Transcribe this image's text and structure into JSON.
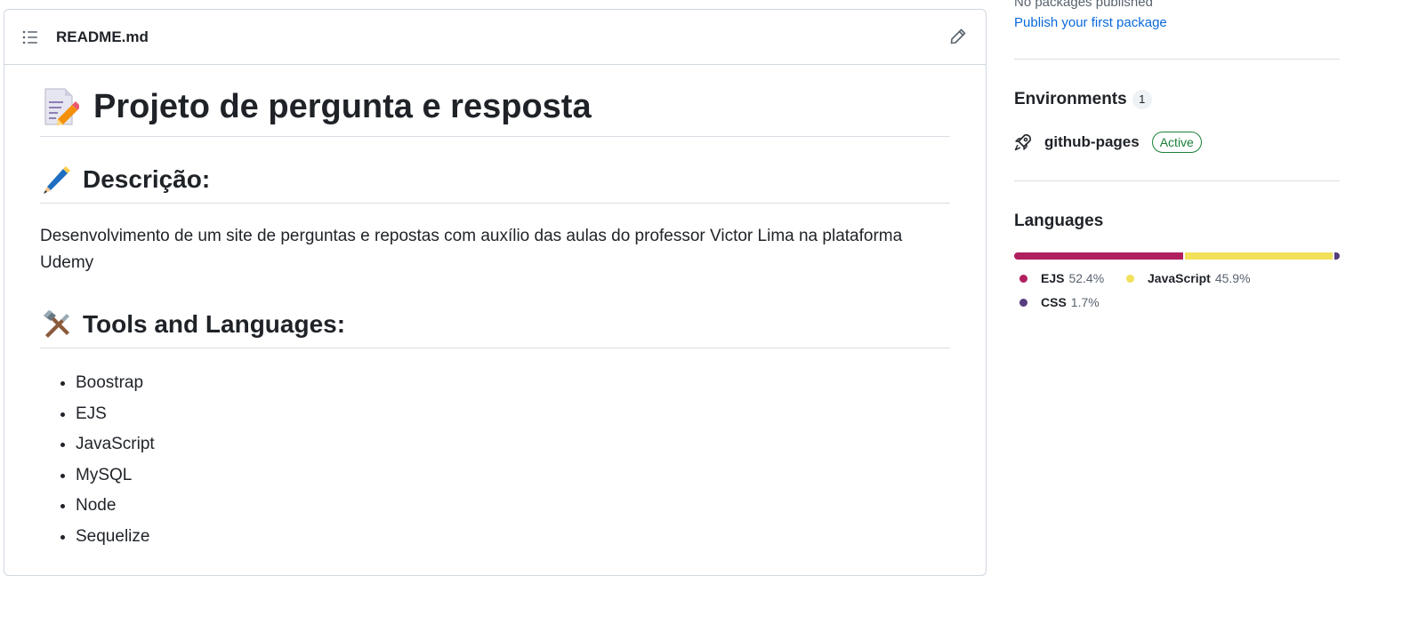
{
  "readme": {
    "filename": "README.md",
    "title": "Projeto de pergunta e resposta",
    "description_heading": "Descrição:",
    "description_text": "Desenvolvimento de um site de perguntas e repostas com auxílio das aulas do professor Victor Lima na plataforma Udemy",
    "tools_heading": "Tools and Languages:",
    "tools": [
      "Boostrap",
      "EJS",
      "JavaScript",
      "MySQL",
      "Node",
      "Sequelize"
    ]
  },
  "sidebar": {
    "packages": {
      "empty_text": "No packages published",
      "publish_link": "Publish your first package"
    },
    "environments": {
      "title": "Environments",
      "count": "1",
      "items": [
        {
          "name": "github-pages",
          "status": "Active"
        }
      ]
    },
    "languages": {
      "title": "Languages",
      "items": [
        {
          "name": "EJS",
          "percent": "52.4%",
          "value": 52.4,
          "color": "#b01f5e"
        },
        {
          "name": "JavaScript",
          "percent": "45.9%",
          "value": 45.9,
          "color": "#f1e05a"
        },
        {
          "name": "CSS",
          "percent": "1.7%",
          "value": 1.7,
          "color": "#563d7c"
        }
      ]
    }
  },
  "icons": {
    "toc": "list-unordered-icon",
    "edit": "pencil-icon",
    "title_emoji": "memo-icon",
    "description_emoji": "pen-icon",
    "tools_emoji": "hammer-and-wrench-icon",
    "environment": "rocket-icon"
  }
}
